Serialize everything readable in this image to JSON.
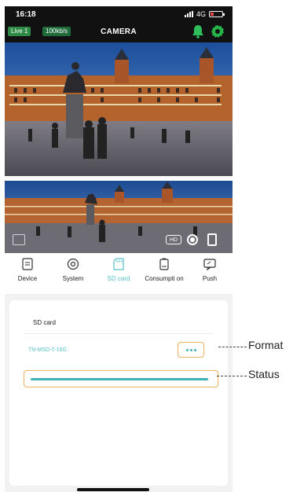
{
  "status_bar": {
    "time": "16:18",
    "network": "4G"
  },
  "header": {
    "live_badge": "Live 1",
    "rate_badge": "100kb/s",
    "title": "CAMERA"
  },
  "video": {
    "hd_label": "HD"
  },
  "tabs": [
    {
      "label": "Device",
      "icon": "device-icon"
    },
    {
      "label": "System",
      "icon": "system-icon"
    },
    {
      "label": "SD card",
      "icon": "sd-card-icon"
    },
    {
      "label": "Consumpti on",
      "icon": "battery-consumption-icon"
    },
    {
      "label": "Push",
      "icon": "push-icon"
    }
  ],
  "sd_panel": {
    "title": "SD card",
    "card_info": "TN-MSD-T-16G",
    "status_fill": 1.0
  },
  "callouts": {
    "format": "Format",
    "status": "Status"
  },
  "colors": {
    "accent": "#5ac2c8",
    "highlight": "#f0b15b",
    "header_bg": "#111111",
    "bell": "#2fbf5a",
    "gear": "#27b24a"
  }
}
